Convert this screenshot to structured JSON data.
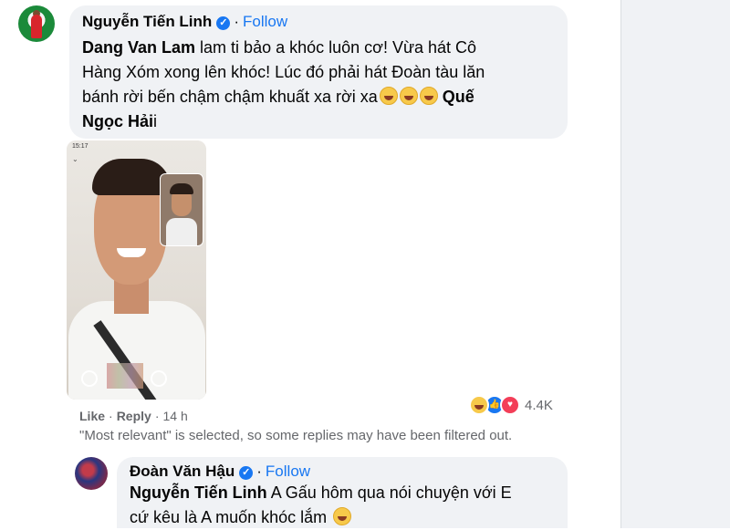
{
  "comment": {
    "author": "Nguyễn Tiến Linh",
    "follow_label": "Follow",
    "mention": "Dang Van Lam",
    "lines": [
      "lam ti bảo a khóc luôn cơ! Vừa hát Cô",
      "Hàng Xóm xong lên khóc! Lúc đó phải hát Đoàn tàu lăn",
      "bánh rời bến chậm chậm khuất xa rời xa"
    ],
    "trailing_mention_1": "Quế",
    "trailing_mention_2": "Ngọc Hải",
    "trailing_char": "i",
    "photo_time": "15:17",
    "actions": {
      "like": "Like",
      "reply": "Reply",
      "time": "14 h"
    },
    "reactions": {
      "icons": [
        "haha-icon",
        "like-icon",
        "love-icon"
      ],
      "count": "4.4K"
    }
  },
  "filter_note": "\"Most relevant\" is selected, so some replies may have been filtered out.",
  "reply": {
    "author": "Đoàn Văn Hậu",
    "follow_label": "Follow",
    "mention": "Nguyễn Tiến Linh",
    "line1": "A Gấu hôm qua nói chuyện với E",
    "line2": "cứ kêu là A muốn khóc lắm"
  },
  "colors": {
    "accent": "#1877f2",
    "bubble": "#f0f2f5",
    "meta_text": "#65676b"
  }
}
